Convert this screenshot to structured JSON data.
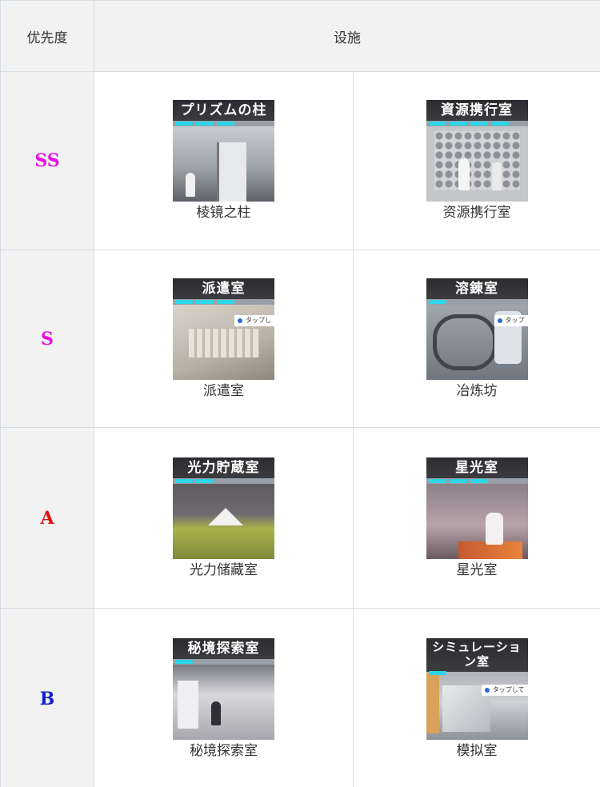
{
  "table": {
    "header": {
      "priority": "优先度",
      "facility": "设施"
    },
    "colors": {
      "SS": "#e60fe0",
      "S": "#e60fe0",
      "A": "#e01010",
      "B": "#1222c8",
      "cyan_bar": "#2bd6e8"
    },
    "rows": [
      {
        "priority": "SS",
        "items": [
          {
            "banner": "プリズムの柱",
            "name": "棱镜之柱"
          },
          {
            "banner": "資源携行室",
            "name": "资源携行室"
          }
        ]
      },
      {
        "priority": "S",
        "items": [
          {
            "banner": "派遣室",
            "name": "派遣室"
          },
          {
            "banner": "溶錬室",
            "name": "冶炼坊"
          }
        ]
      },
      {
        "priority": "A",
        "items": [
          {
            "banner": "光力貯蔵室",
            "name": "光力储藏室"
          },
          {
            "banner": "星光室",
            "name": "星光室"
          }
        ]
      },
      {
        "priority": "B",
        "items": [
          {
            "banner": "秘境探索室",
            "name": "秘境探索室"
          },
          {
            "banner": "シミュレーション室",
            "name": "模拟室"
          }
        ]
      }
    ]
  }
}
